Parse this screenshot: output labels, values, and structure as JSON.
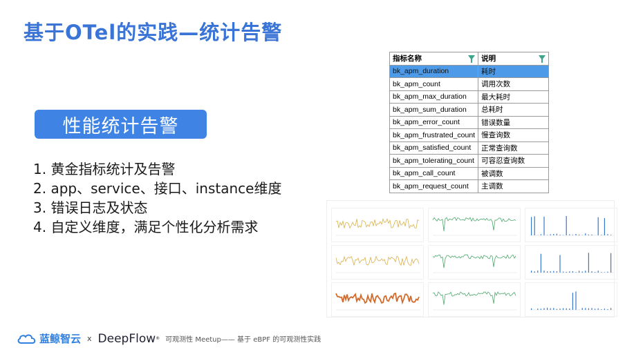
{
  "slide": {
    "title": "基于OTel的实践—统计告警",
    "badge": "性能统计告警",
    "bullets": [
      "1. 黄金指标统计及告警",
      "2. app、service、接口、instance维度",
      "3. 错误日志及状态",
      "4. 自定义维度，满足个性化分析需求"
    ]
  },
  "table": {
    "headers": [
      "指标名称",
      "说明"
    ],
    "rows": [
      [
        "bk_apm_duration",
        "耗时"
      ],
      [
        "bk_apm_count",
        "调用次数"
      ],
      [
        "bk_apm_max_duration",
        "最大耗时"
      ],
      [
        "bk_apm_sum_duration",
        "总耗时"
      ],
      [
        "bk_apm_error_count",
        "错误数量"
      ],
      [
        "bk_apm_frustrated_count",
        "慢查询数"
      ],
      [
        "bk_apm_satisfied_count",
        "正常查询数"
      ],
      [
        "bk_apm_tolerating_count",
        "可容忍查询数"
      ],
      [
        "bk_apm_call_count",
        "被调数"
      ],
      [
        "bk_apm_request_count",
        "主调数"
      ]
    ],
    "selected_row": 0
  },
  "dashboard": {
    "summary_label": "",
    "panels": [
      {
        "title": "",
        "color": "#d9b04a"
      },
      {
        "title": "",
        "color": "#4aa86a"
      },
      {
        "title": "",
        "color": "#3a78c8"
      },
      {
        "title": "",
        "color": "#d9b04a"
      },
      {
        "title": "",
        "color": "#4aa86a"
      },
      {
        "title": "",
        "color": "#3a78c8"
      },
      {
        "title": "",
        "color": "#d36a2a"
      },
      {
        "title": "",
        "color": "#4aa86a"
      },
      {
        "title": "",
        "color": "#3a78c8"
      }
    ]
  },
  "footer": {
    "logo1": "蓝鲸智云",
    "separator": "x",
    "logo2": "DeepFlow",
    "registered": "®",
    "note": "可观测性 Meetup—— 基于 eBPF 的可观测性实践"
  },
  "colors": {
    "title": "#3a74d6",
    "badge": "#3f84e5",
    "selected_row": "#4d9be8",
    "filter": "#3ca58a"
  }
}
